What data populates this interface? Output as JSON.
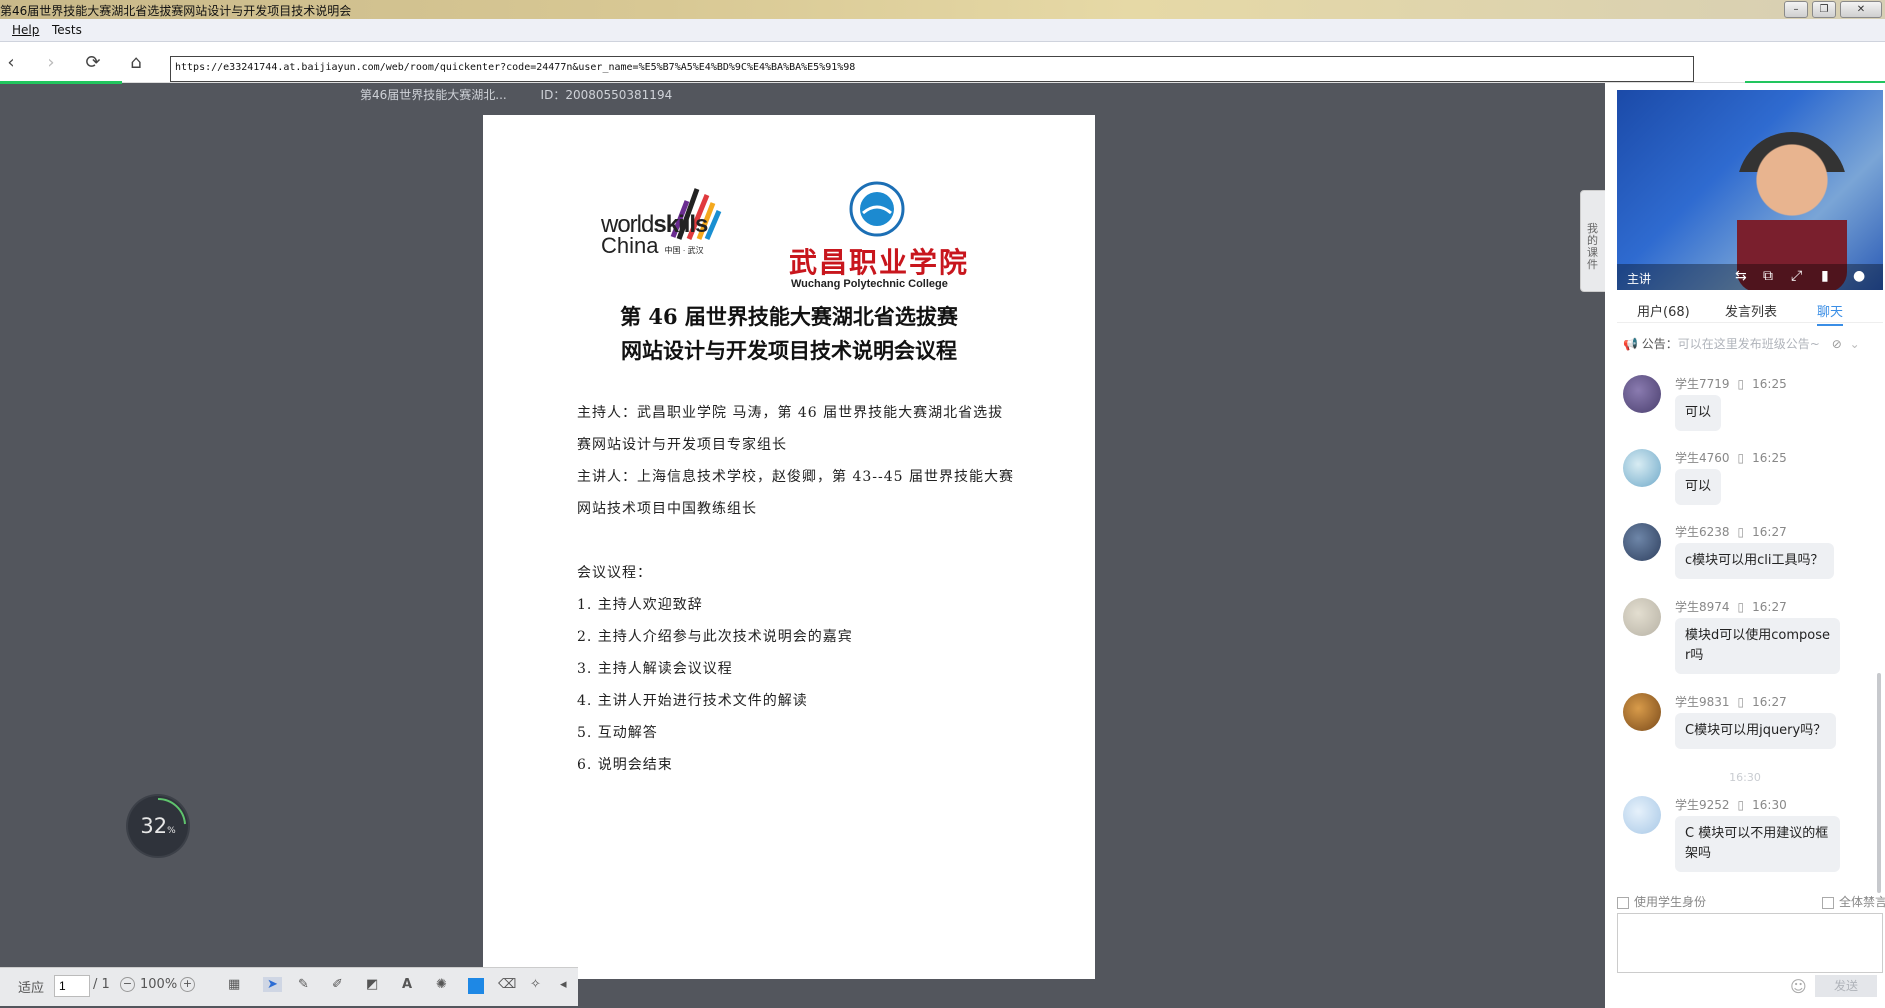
{
  "window": {
    "title": "第46届世界技能大赛湖北省选拔赛网站设计与开发项目技术说明会",
    "controls": [
      "minimize",
      "restore",
      "close"
    ]
  },
  "menu": {
    "items": [
      "Help",
      "Tests"
    ]
  },
  "nav": {
    "url": "https://e33241744.at.baijiayun.com/web/room/quickenter?code=24477n&user_name=%E5%B7%A5%E4%BD%9C%E4%BA%BA%E5%91%98"
  },
  "docinfo": {
    "name": "第46届世界技能大赛湖北...",
    "id": "ID：20080550381194"
  },
  "document": {
    "logo_ws_line1_prefix": "world",
    "logo_ws_line1_bold": "skills",
    "logo_ws_line2": "China",
    "logo_ws_city": "中国 · 武汉",
    "logo_wc_cn": "武昌职业学院",
    "logo_wc_en": "Wuchang Polytechnic College",
    "title1": "第 46 届世界技能大赛湖北省选拔赛",
    "title2": "网站设计与开发项目技术说明会议程",
    "host": "主持人：武昌职业学院 马涛，第 46 届世界技能大赛湖北省选拔赛网站设计与开发项目专家组长",
    "speaker": "主讲人：上海信息技术学校，赵俊卿，第 43--45 届世界技能大赛网站技术项目中国教练组长",
    "agenda_label": "会议议程：",
    "agenda": [
      "1. 主持人欢迎致辞",
      "2. 主持人介绍参与此次技术说明会的嘉宾",
      "3. 主持人解读会议议程",
      "4. 主讲人开始进行技术文件的解读",
      "5. 互动解答",
      "6. 说明会结束"
    ]
  },
  "progress": {
    "value": "32",
    "unit": "%"
  },
  "toolbar": {
    "fit_label": "适应",
    "page_current": "1",
    "page_total": "/ 1",
    "zoom": "100%",
    "minus": "−",
    "plus": "+"
  },
  "side_handle": "我的课件",
  "video": {
    "role": "主讲"
  },
  "tabs": [
    "用户(68)",
    "发言列表",
    "聊天"
  ],
  "notice": {
    "label": "公告：",
    "placeholder": "可以在这里发布班级公告~"
  },
  "messages": [
    {
      "user": "学生7719",
      "time": "16:25",
      "text": "可以",
      "color": "#4a3f6e"
    },
    {
      "user": "学生4760",
      "time": "16:25",
      "text": "可以",
      "color": "#6fa9c9"
    },
    {
      "user": "学生6238",
      "time": "16:27",
      "text": "c模块可以用cli工具吗？",
      "color": "#2e3f5e"
    },
    {
      "user": "学生8974",
      "time": "16:27",
      "text": "模块d可以使用composer吗",
      "color": "#b7b2a5"
    },
    {
      "user": "学生9831",
      "time": "16:27",
      "text": "C模块可以用jquery吗？",
      "color": "#7a4a1a"
    },
    {
      "user": "学生9252",
      "time": "16:30",
      "text": "C 模块可以不用建议的框架吗",
      "color": "#a8c8e6"
    }
  ],
  "separator_time": "16:30",
  "chat_options": {
    "use_student": "使用学生身份",
    "mute_all": "全体禁言"
  },
  "send_label": "发送"
}
